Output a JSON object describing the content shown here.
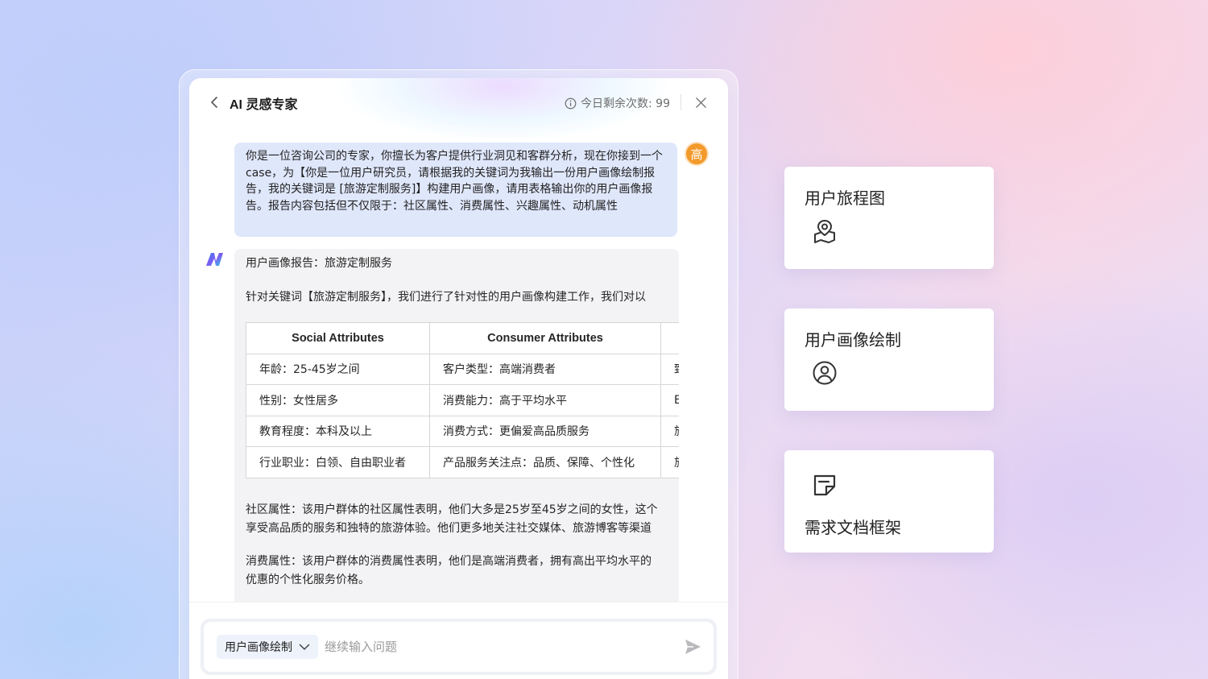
{
  "header": {
    "title": "AI 灵感专家",
    "quota_text": "今日剩余次数: 99"
  },
  "user_message": {
    "avatar_text": "高",
    "text": "你是一位咨询公司的专家，你擅长为客户提供行业洞见和客群分析，现在你接到一个case，为【你是一位用户研究员，请根据我的关键词为我输出一份用户画像绘制报告，我的关键词是 [旅游定制服务]】构建用户画像，请用表格输出你的用户画像报告。报告内容包括但不仅限于：社区属性、消费属性、兴趣属性、动机属性"
  },
  "ai_message": {
    "title": "用户画像报告：旅游定制服务",
    "intro": "针对关键词【旅游定制服务】，我们进行了针对性的用户画像构建工作，我们对以",
    "table": {
      "headers": [
        "Social Attributes",
        "Consumer Attributes",
        ""
      ],
      "rows": [
        [
          "年龄：25-45岁之间",
          "客户类型：高端消费者",
          "致"
        ],
        [
          "性别：女性居多",
          "消费能力：高于平均水平",
          "E"
        ],
        [
          "教育程度：本科及以上",
          "消费方式：更偏爱高品质服务",
          "旅"
        ],
        [
          "行业职业：白领、自由职业者",
          "产品服务关注点：品质、保障、个性化",
          "旅"
        ]
      ]
    },
    "paragraph1_line1": "社区属性：该用户群体的社区属性表明，他们大多是25岁至45岁之间的女性，这个",
    "paragraph1_line2": "享受高品质的服务和独特的旅游体验。他们更多地关注社交媒体、旅游博客等渠道",
    "paragraph2_line1": "消费属性：该用户群体的消费属性表明，他们是高端消费者，拥有高出平均水平的",
    "paragraph2_line2": "优惠的个性化服务价格。"
  },
  "input": {
    "mode_label": "用户画像绘制",
    "placeholder": "继续输入问题"
  },
  "cards": [
    {
      "label": "用户旅程图",
      "icon": "map-pin-icon"
    },
    {
      "label": "用户画像绘制",
      "icon": "user-circle-icon"
    },
    {
      "label": "需求文档框架",
      "icon": "note-icon"
    }
  ],
  "colors": {
    "accent": "#f39a2c",
    "user_bubble": "#dfe7fb",
    "ai_bubble": "#f3f3f5"
  }
}
